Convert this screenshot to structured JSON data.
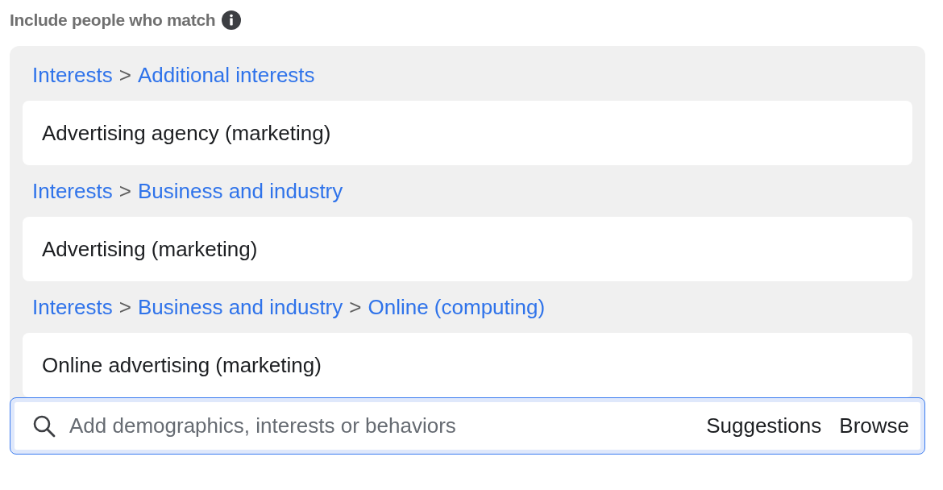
{
  "section_title": "Include people who match",
  "path_separator": ">",
  "groups": [
    {
      "path": [
        "Interests",
        "Additional interests"
      ],
      "item": "Advertising agency (marketing)"
    },
    {
      "path": [
        "Interests",
        "Business and industry"
      ],
      "item": "Advertising (marketing)"
    },
    {
      "path": [
        "Interests",
        "Business and industry",
        "Online (computing)"
      ],
      "item": "Online advertising (marketing)"
    }
  ],
  "search": {
    "placeholder": "Add demographics, interests or behaviors",
    "actions": [
      "Suggestions",
      "Browse"
    ]
  }
}
